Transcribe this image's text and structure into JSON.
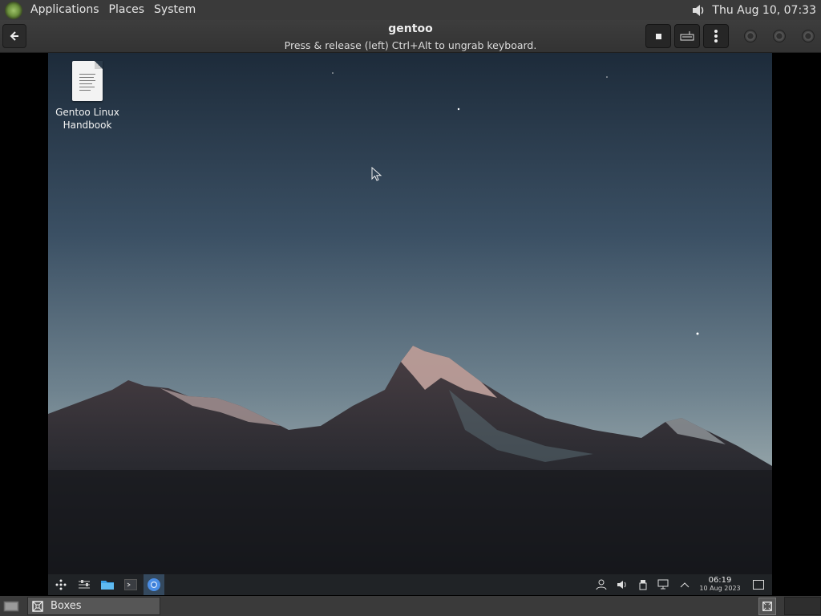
{
  "host_panel": {
    "menus": [
      "Applications",
      "Places",
      "System"
    ],
    "clock": "Thu Aug 10, 07:33",
    "volume_icon": "speaker-icon"
  },
  "boxes": {
    "title": "gentoo",
    "subtitle": "Press & release (left) Ctrl+Alt to ungrab keyboard.",
    "back_icon": "arrow-left-icon"
  },
  "guest": {
    "desktop_icon_label": "Gentoo Linux Handbook",
    "clock_time": "06:19",
    "clock_date": "10 Aug 2023",
    "taskbar_apps": [
      "launcher",
      "system-monitor",
      "file-manager",
      "terminal",
      "chromium"
    ]
  },
  "host_bottom": {
    "task_label": "Boxes"
  },
  "colors": {
    "panel": "#3a3a3a",
    "guest_taskbar": "#202326",
    "active_app_bg": "#34495e"
  }
}
